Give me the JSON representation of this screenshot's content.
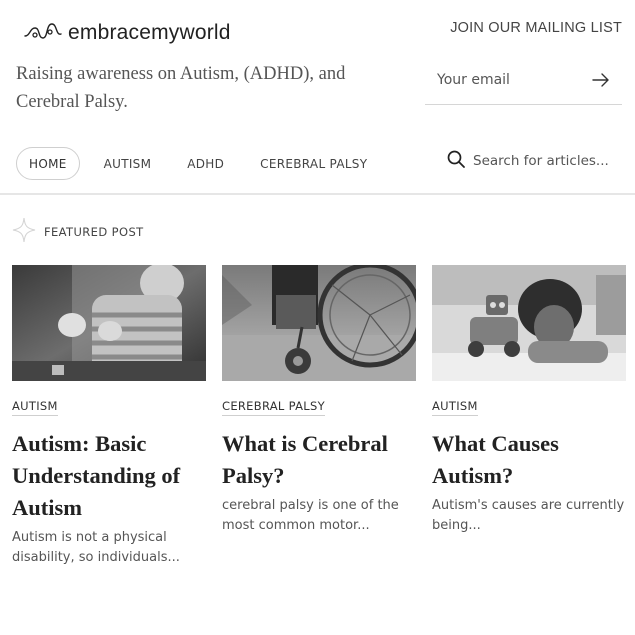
{
  "brand": {
    "logo_icon": "wave-logo-icon",
    "name": "embracemyworld"
  },
  "tagline": "Raising awareness on Autism, (ADHD), and Cerebral Palsy.",
  "mailing": {
    "title": "JOIN OUR MAILING LIST",
    "placeholder": "Your email",
    "submit_icon": "arrow-right-icon"
  },
  "nav": {
    "items": [
      {
        "label": "HOME",
        "active": true
      },
      {
        "label": "AUTISM",
        "active": false
      },
      {
        "label": "ADHD",
        "active": false
      },
      {
        "label": "CEREBRAL PALSY",
        "active": false
      }
    ]
  },
  "search": {
    "icon": "search-icon",
    "placeholder": "Search for articles..."
  },
  "featured": {
    "icon": "sparkle-icon",
    "label": "FEATURED POST"
  },
  "posts": [
    {
      "category": "AUTISM",
      "title": "Autism: Basic Understanding of Autism",
      "excerpt": "Autism is not a physical disability, so individuals...",
      "image": "child-playing-with-blocks-photo"
    },
    {
      "category": "CEREBRAL PALSY",
      "title": "What is Cerebral Palsy?",
      "excerpt": "cerebral palsy is one of the most common motor...",
      "image": "wheelchair-photo"
    },
    {
      "category": "AUTISM",
      "title": "What Causes Autism?",
      "excerpt": "Autism's causes are currently being...",
      "image": "child-with-toy-robot-photo"
    }
  ]
}
